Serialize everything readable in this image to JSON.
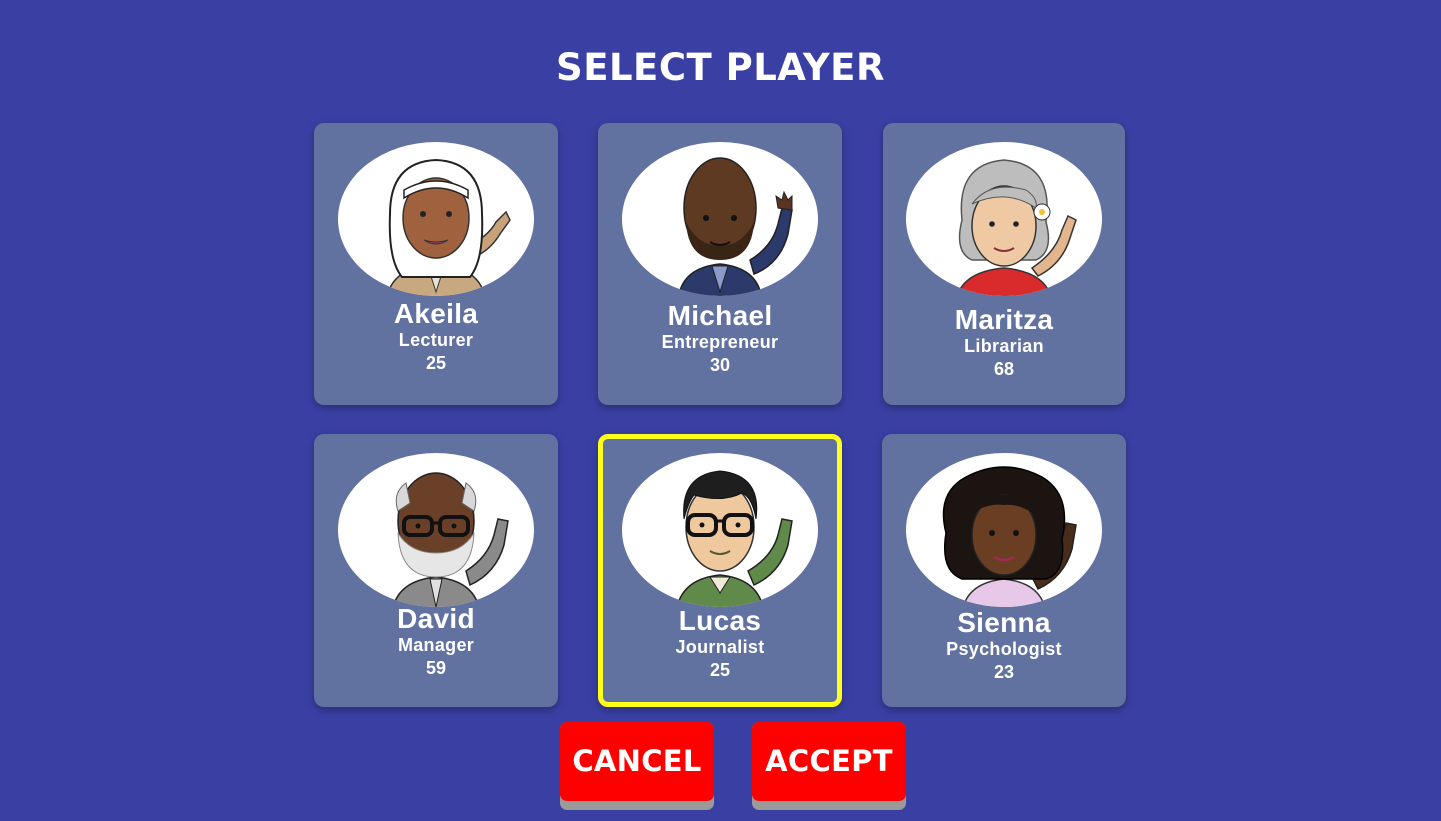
{
  "screen": {
    "title": "SELECT PLAYER"
  },
  "players": [
    {
      "name": "Akeila",
      "job": "Lecturer",
      "age": "25",
      "selected": false,
      "avatar": "akeila-portrait"
    },
    {
      "name": "Michael",
      "job": "Entrepreneur",
      "age": "30",
      "selected": false,
      "avatar": "michael-portrait"
    },
    {
      "name": "Maritza",
      "job": "Librarian",
      "age": "68",
      "selected": false,
      "avatar": "maritza-portrait"
    },
    {
      "name": "David",
      "job": "Manager",
      "age": "59",
      "selected": false,
      "avatar": "david-portrait"
    },
    {
      "name": "Lucas",
      "job": "Journalist",
      "age": "25",
      "selected": true,
      "avatar": "lucas-portrait"
    },
    {
      "name": "Sienna",
      "job": "Psychologist",
      "age": "23",
      "selected": false,
      "avatar": "sienna-portrait"
    }
  ],
  "buttons": {
    "cancel_label": "CANCEL",
    "accept_label": "ACCEPT"
  },
  "colors": {
    "background": "#3a3fa3",
    "card": "#6171a0",
    "selected_border": "#ffff1a",
    "button": "#ff0000",
    "button_shadow": "#9a9a9a"
  }
}
